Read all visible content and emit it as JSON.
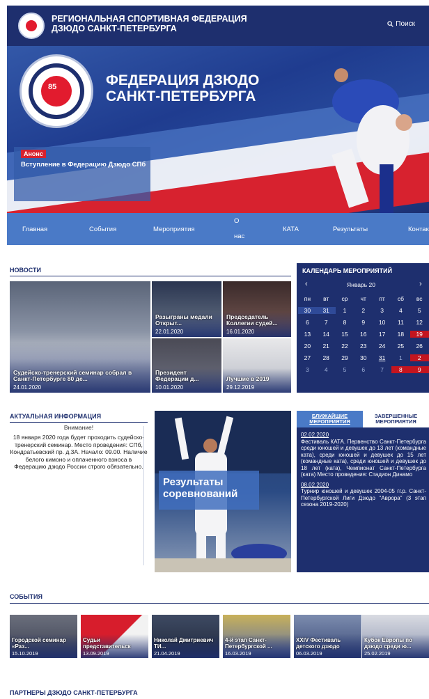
{
  "header": {
    "title": "Региональная спортивная федерация дзюдо Санкт-Петербурга",
    "search_label": "Поиск"
  },
  "hero": {
    "title_line1": "Федерация дзюдо",
    "title_line2": "Санкт-Петербурга",
    "logo_badge": "85",
    "announce_label": "Анонс",
    "announce_text": "Вступление в Федерацию Дзюдо СПб"
  },
  "nav": {
    "items": [
      "Главная",
      "События",
      "Мероприятия",
      "О нас",
      "КАТА",
      "Результаты",
      "Контакты"
    ]
  },
  "news": {
    "title": "Новости",
    "items": [
      {
        "caption": "Судейско-тренерский семинар собрал в Санкт-Петербурге 80 де...",
        "date": "24.01.2020"
      },
      {
        "caption": "Разыграны медали Открыт...",
        "date": "22.01.2020"
      },
      {
        "caption": "Председатель Коллегии судей...",
        "date": "16.01.2020"
      },
      {
        "caption": "Президент Федерации д...",
        "date": "10.01.2020"
      },
      {
        "caption": "Лучшие в 2019",
        "date": "29.12.2019"
      }
    ]
  },
  "calendar": {
    "title": "Календарь мероприятий",
    "month": "Январь 20",
    "prev": "‹",
    "next": "›",
    "weekdays": [
      "пн",
      "вт",
      "ср",
      "чт",
      "пт",
      "сб",
      "вс"
    ],
    "weeks": [
      [
        "30",
        "31",
        "1",
        "2",
        "3",
        "4",
        "5"
      ],
      [
        "6",
        "7",
        "8",
        "9",
        "10",
        "11",
        "12"
      ],
      [
        "13",
        "14",
        "15",
        "16",
        "17",
        "18",
        "19"
      ],
      [
        "20",
        "21",
        "22",
        "23",
        "24",
        "25",
        "26"
      ],
      [
        "27",
        "28",
        "29",
        "30",
        "31",
        "1",
        "2"
      ],
      [
        "3",
        "4",
        "5",
        "6",
        "7",
        "8",
        "9"
      ]
    ]
  },
  "info": {
    "title": "Актуальная информация",
    "heading": "Внимание!",
    "text": "18 января 2020 года будет проходить судейско-тренерский семинар. Место проведения: СПб, Кондратьевский пр. д.3А. Начало: 09.00. Наличие белого кимоно и оплаченного взноса в Федерацию дзюдо России строго обязательно."
  },
  "results": {
    "label": "Результаты соревнований"
  },
  "events_box": {
    "tab_upcoming": "Ближайшие мероприятия",
    "tab_finished": "Завершенные мероприятия",
    "items": [
      {
        "date": "02.02.2020",
        "text": "Фестиваль КАТА. Первенство Санкт-Петербурга среди юношей и девушек до 13 лет (командные ката), среди юношей и девушек до 15 лет (командные ката), среди юношей и девушек до 18 лет (ката), Чемпионат Санкт-Петербурга (ката) Место проведения: Стадион Динамо"
      },
      {
        "date": "08.02.2020",
        "text": "Турнир юношей и девушек 2004-05 гг.р. Санкт-Петербургской Лиги Дзюдо \"Аврора\" (3 этап сезона 2019-2020)"
      }
    ]
  },
  "events": {
    "title": "События",
    "items": [
      {
        "caption": "Городской семинар «Раз...",
        "date": "15.10.2019"
      },
      {
        "caption": "Судьи представительск",
        "date": "13.09.2019"
      },
      {
        "caption": "Николай Дмитриевич ТИ...",
        "date": "21.04.2019"
      },
      {
        "caption": "4-й этап Санкт-Петербургской ...",
        "date": "16.03.2019"
      },
      {
        "caption": "XXIV Фестиваль детского дзюдо",
        "date": "06.03.2019"
      },
      {
        "caption": "Кубок Европы по дзюдо среди ю...",
        "date": "25.02.2019"
      }
    ]
  },
  "partners": {
    "title": "Партнеры дзюдо Санкт-Петербурга"
  },
  "colors": {
    "brand_navy": "#1e2f6e",
    "nav_blue": "#4a7ac7",
    "accent_red": "#d7222f"
  }
}
